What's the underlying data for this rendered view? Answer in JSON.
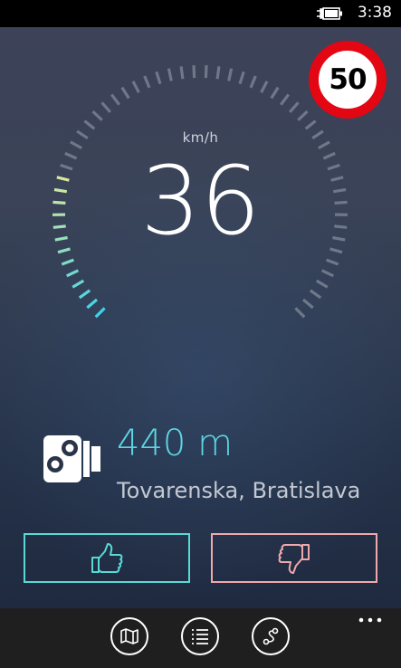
{
  "status_bar": {
    "time": "3:38",
    "battery_icon": "battery-charging-icon"
  },
  "speedometer": {
    "unit": "km/h",
    "speed": "36"
  },
  "speed_limit": {
    "value": "50",
    "ring_color": "#e30613"
  },
  "speed_camera": {
    "icon": "speed-camera-icon",
    "distance": "440 m",
    "street": "Tovarenska, Bratislava"
  },
  "vote": {
    "up_icon": "thumbs-up-icon",
    "up_color": "#59d9d5",
    "down_icon": "thumbs-down-icon",
    "down_color": "#f0a8ac"
  },
  "app_bar": {
    "buttons": [
      {
        "icon": "map-icon"
      },
      {
        "icon": "list-icon"
      },
      {
        "icon": "route-icon"
      }
    ],
    "more_icon": "more-dots-icon"
  }
}
